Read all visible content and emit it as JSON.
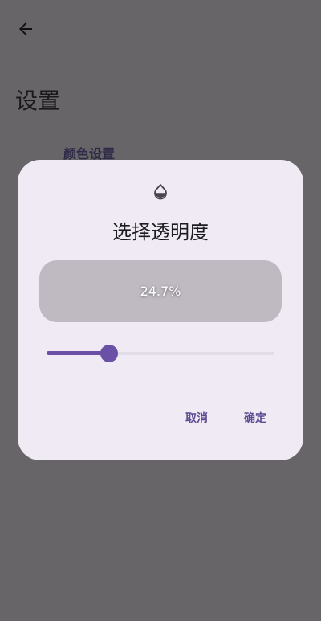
{
  "screen": {
    "title": "设置",
    "section_header": "颜色设置"
  },
  "dialog": {
    "icon": "opacity-drop-icon",
    "title": "选择透明度",
    "preview_value": "24.7%",
    "slider_value_fraction": 0.274,
    "cancel_label": "取消",
    "confirm_label": "确定"
  },
  "colors": {
    "scrim_background": "#676567",
    "dialog_surface": "#efeaf4",
    "preview_surface": "#bfb9c2",
    "accent": "#6a51a6",
    "button_text": "#5e4a93"
  }
}
